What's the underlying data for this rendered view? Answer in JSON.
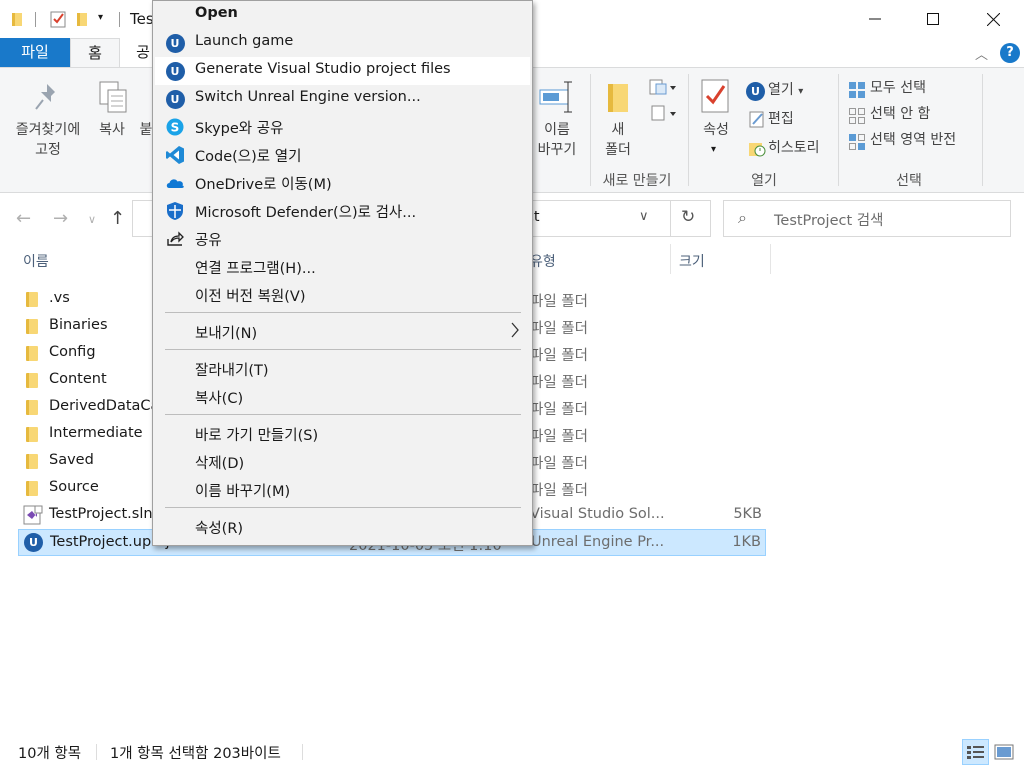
{
  "window": {
    "title": "Tes",
    "controls": {
      "minimize": "minimize-icon",
      "maximize": "maximize-icon",
      "close": "close-icon"
    }
  },
  "ribbon": {
    "tabs": [
      "파일",
      "홈",
      "공"
    ],
    "pin_label_1": "즐겨찾기에",
    "pin_label_2": "고정",
    "copy_label": "복사",
    "paste_partial": "붙",
    "rename_label_1": "이름",
    "rename_label_2": "바꾸기",
    "new_folder_label_1": "새",
    "new_folder_label_2": "폴더",
    "group_new": "새로 만들기",
    "properties_label": "속성",
    "open_label": "열기",
    "edit_label": "편집",
    "history_label": "히스토리",
    "group_open": "열기",
    "select_all": "모두 선택",
    "select_none": "선택 안 함",
    "invert_selection": "선택 영역 반전",
    "group_select": "선택"
  },
  "address": {
    "path_partial": "ject",
    "search_placeholder": "TestProject 검색"
  },
  "columns": {
    "name": "이름",
    "type": "유형",
    "size": "크기"
  },
  "files": [
    {
      "name": ".vs",
      "type": "파일 폴더",
      "size": "",
      "date": "",
      "kind": "folder"
    },
    {
      "name": "Binaries",
      "type": "파일 폴더",
      "size": "",
      "date": "",
      "kind": "folder"
    },
    {
      "name": "Config",
      "type": "파일 폴더",
      "size": "",
      "date": "",
      "kind": "folder"
    },
    {
      "name": "Content",
      "type": "파일 폴더",
      "size": "",
      "date": "",
      "kind": "folder"
    },
    {
      "name": "DerivedDataCa",
      "type": "파일 폴더",
      "size": "",
      "date": "",
      "kind": "folder"
    },
    {
      "name": "Intermediate",
      "type": "파일 폴더",
      "size": "",
      "date": "",
      "kind": "folder"
    },
    {
      "name": "Saved",
      "type": "파일 폴더",
      "size": "",
      "date": "",
      "kind": "folder"
    },
    {
      "name": "Source",
      "type": "파일 폴더",
      "size": "",
      "date": "",
      "kind": "folder"
    },
    {
      "name": "TestProject.sln",
      "type": "Visual Studio Sol...",
      "size": "5KB",
      "date": "",
      "kind": "sln"
    },
    {
      "name": "TestProject.uproject",
      "type": "Unreal Engine Pr...",
      "size": "1KB",
      "date": "2021-10-05 오전 1:10",
      "kind": "uproject"
    }
  ],
  "context_menu": {
    "items": [
      {
        "label": "Open",
        "icon": "",
        "bold": true
      },
      {
        "label": "Launch game",
        "icon": "unreal-icon"
      },
      {
        "label": "Generate Visual Studio project files",
        "icon": "unreal-icon"
      },
      {
        "label": "Switch Unreal Engine version...",
        "icon": "unreal-icon"
      },
      {
        "label": "Skype와 공유",
        "icon": "skype-icon"
      },
      {
        "label": "Code(으)로 열기",
        "icon": "vscode-icon"
      },
      {
        "label": "OneDrive로 이동(M)",
        "icon": "onedrive-icon"
      },
      {
        "label": "Microsoft Defender(으)로 검사...",
        "icon": "defender-icon"
      },
      {
        "label": "공유",
        "icon": "share-icon"
      },
      {
        "label": "연결 프로그램(H)...",
        "icon": ""
      },
      {
        "label": "이전 버전 복원(V)",
        "icon": ""
      },
      {
        "label": "보내기(N)",
        "icon": ""
      },
      {
        "label": "잘라내기(T)",
        "icon": ""
      },
      {
        "label": "복사(C)",
        "icon": ""
      },
      {
        "label": "바로 가기 만들기(S)",
        "icon": ""
      },
      {
        "label": "삭제(D)",
        "icon": ""
      },
      {
        "label": "이름 바꾸기(M)",
        "icon": ""
      },
      {
        "label": "속성(R)",
        "icon": ""
      }
    ]
  },
  "status": {
    "item_count": "10개 항목",
    "selection": "1개 항목 선택함 203바이트"
  },
  "colors": {
    "accent": "#1979ca",
    "selection": "#cce8ff",
    "unreal": "#1f5ea8"
  }
}
